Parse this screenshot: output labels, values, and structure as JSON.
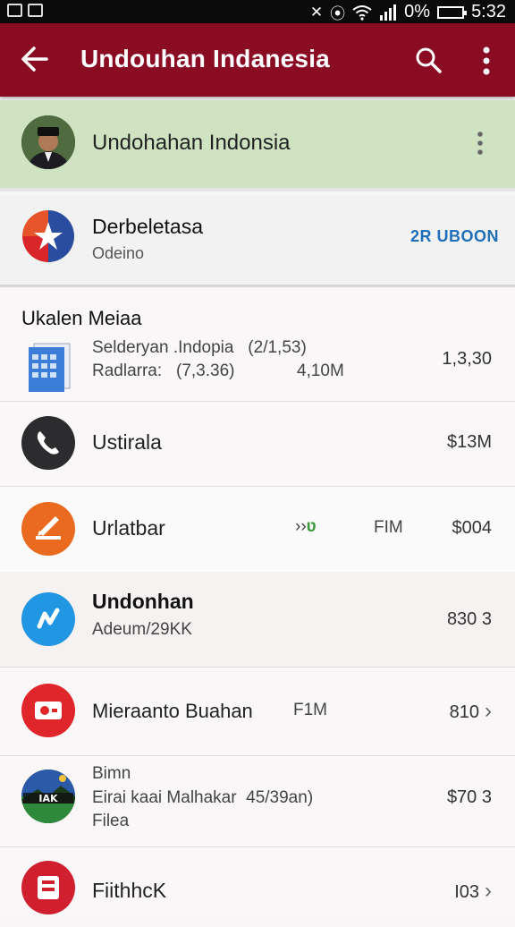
{
  "status_bar": {
    "battery_percent": "0%",
    "time": "5:32"
  },
  "app_bar": {
    "title": "Undouhan Indanesia",
    "back_icon": "arrow-left-icon",
    "search_icon": "search-icon",
    "more_icon": "more-vert-icon"
  },
  "account": {
    "name": "Undohahan Indonsia"
  },
  "featured": {
    "title": "Derbeletasa",
    "subtitle": "Odeino",
    "action": "2R UBOON"
  },
  "section": {
    "title": "Ukalen Meiaa"
  },
  "rows": [
    {
      "line1": "Selderyan .Indopia",
      "line1_extra": "(2/1,53)",
      "line2": "Radlarra:",
      "line2_extra": "(7,3.36)",
      "mid": "4,10M",
      "value": "1,3,30"
    },
    {
      "line1": "Ustirala",
      "value": "$13M"
    },
    {
      "line1": "Urlatbar",
      "mid_arrow": "››",
      "mid_arrow2": "ʋ",
      "mid": "FIM",
      "value": "$004"
    },
    {
      "line1": "Undonhan",
      "line2": "Adeum/29KK",
      "value": "830 3"
    },
    {
      "line1": "Mieraanto Buahan",
      "mid": "F1M",
      "value": "810",
      "chevron": "›"
    },
    {
      "line0": "Bimn",
      "line1": "Eirai kaai Malhakar",
      "line1_extra": "45/39an)",
      "line2": "Filea",
      "value": "$70 3"
    },
    {
      "line1": "FiithhcK",
      "value": "I03",
      "chevron": "›"
    }
  ],
  "colors": {
    "app_bar": "#8a0c23",
    "account_bg": "#cfe3c2",
    "action_blue": "#1f6fb8"
  }
}
